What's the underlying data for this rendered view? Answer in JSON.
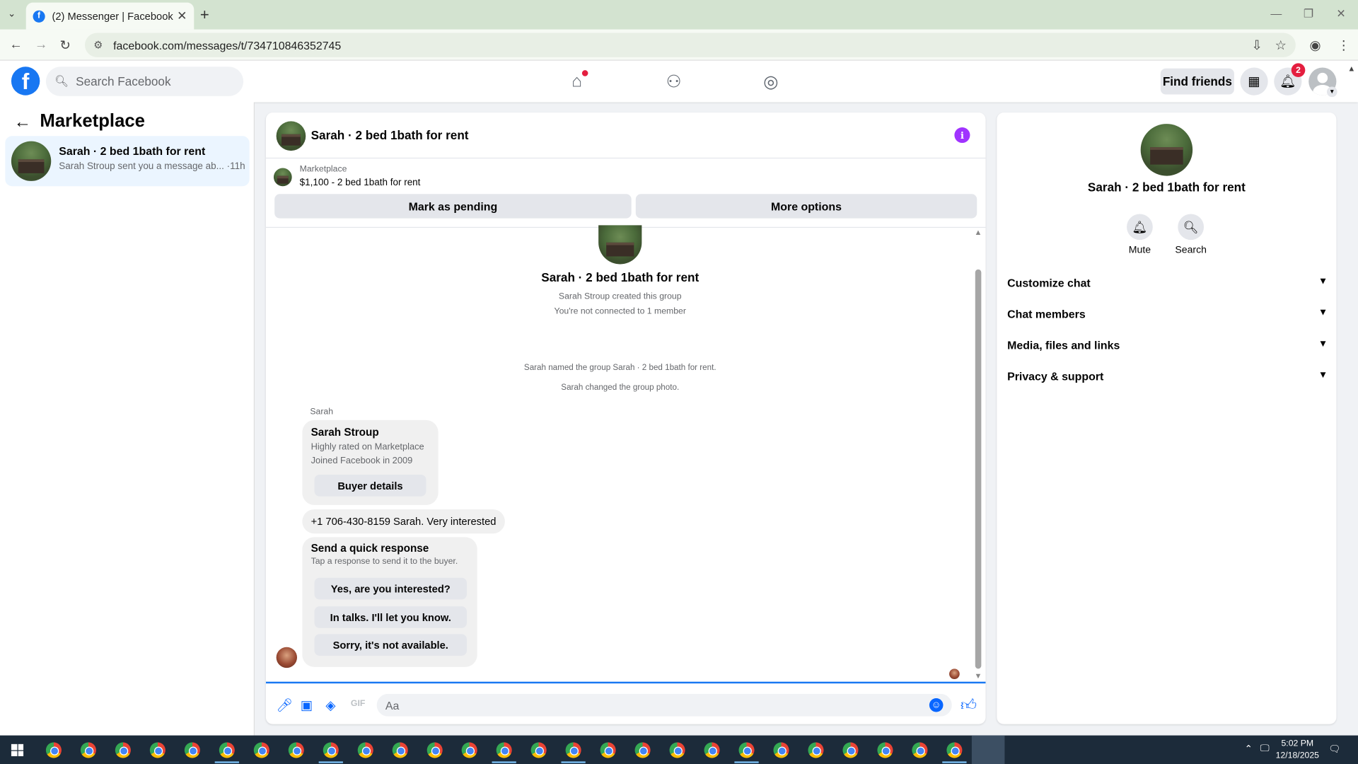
{
  "browser": {
    "tab_title": "(2) Messenger | Facebook",
    "url": "facebook.com/messages/t/734710846352745"
  },
  "fbnav": {
    "search_placeholder": "Search Facebook",
    "find_friends": "Find friends",
    "notification_count": "2"
  },
  "left": {
    "title": "Marketplace",
    "conversation": {
      "name": "Sarah · 2 bed 1bath for rent",
      "snippet": "Sarah Stroup sent you a message ab... ·11h"
    }
  },
  "chat": {
    "header_name": "Sarah · 2 bed 1bath for rent",
    "marketplace_label": "Marketplace",
    "listing": "$1,100 - 2 bed 1bath for rent",
    "mark_pending": "Mark as pending",
    "more_options": "More options",
    "group_name": "Sarah · 2 bed 1bath for rent",
    "created": "Sarah Stroup created this group",
    "not_connected": "You're not connected to 1 member",
    "named_event": "Sarah named the group Sarah · 2 bed 1bath for rent.",
    "photo_event": "Sarah changed the group photo.",
    "sender": "Sarah",
    "card": {
      "name": "Sarah Stroup",
      "line1": "Highly rated on Marketplace",
      "line2": "Joined Facebook in 2009",
      "button": "Buyer details"
    },
    "message": "+1 706-430-8159 Sarah. Very interested",
    "quick": {
      "title": "Send a quick response",
      "subtitle": "Tap a response to send it to the buyer.",
      "options": [
        "Yes, are you interested?",
        "In talks. I'll let you know.",
        "Sorry, it's not available."
      ]
    },
    "composer_placeholder": "Aa"
  },
  "right": {
    "name": "Sarah · 2 bed 1bath for rent",
    "mute": "Mute",
    "search": "Search",
    "sections": [
      "Customize chat",
      "Chat members",
      "Media, files and links",
      "Privacy & support"
    ]
  },
  "taskbar": {
    "time": "5:02 PM",
    "date": "12/18/2025"
  },
  "colors": {
    "brand": "#1877f2",
    "messenger": "#0866ff",
    "info": "#a033ff",
    "notification": "#e41e3f"
  }
}
